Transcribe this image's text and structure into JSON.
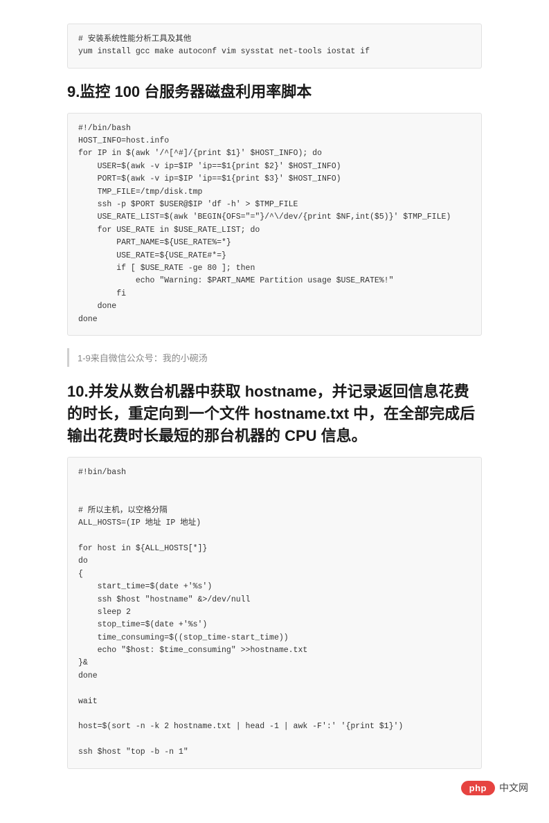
{
  "codeblock1": "# 安装系统性能分析工具及其他\nyum install gcc make autoconf vim sysstat net-tools iostat if",
  "heading1": "9.监控 100 台服务器磁盘利用率脚本",
  "codeblock2": "#!/bin/bash\nHOST_INFO=host.info\nfor IP in $(awk '/^[^#]/{print $1}' $HOST_INFO); do\n    USER=$(awk -v ip=$IP 'ip==$1{print $2}' $HOST_INFO)\n    PORT=$(awk -v ip=$IP 'ip==$1{print $3}' $HOST_INFO)\n    TMP_FILE=/tmp/disk.tmp\n    ssh -p $PORT $USER@$IP 'df -h' > $TMP_FILE\n    USE_RATE_LIST=$(awk 'BEGIN{OFS=\"=\"}/^\\/dev/{print $NF,int($5)}' $TMP_FILE)\n    for USE_RATE in $USE_RATE_LIST; do\n        PART_NAME=${USE_RATE%=*}\n        USE_RATE=${USE_RATE#*=}\n        if [ $USE_RATE -ge 80 ]; then\n            echo \"Warning: $PART_NAME Partition usage $USE_RATE%!\"\n        fi\n    done\ndone",
  "blockquote1": "1-9来自微信公众号：我的小碗汤",
  "heading2": "10.并发从数台机器中获取 hostname，并记录返回信息花费的时长，重定向到一个文件 hostname.txt 中，在全部完成后输出花费时长最短的那台机器的 CPU 信息。",
  "codeblock3": "#!bin/bash\n\n\n# 所以主机，以空格分隔\nALL_HOSTS=(IP 地址 IP 地址)\n\nfor host in ${ALL_HOSTS[*]}\ndo\n{\n    start_time=$(date +'%s')\n    ssh $host \"hostname\" &>/dev/null\n    sleep 2\n    stop_time=$(date +'%s')\n    time_consuming=$((stop_time-start_time))\n    echo \"$host: $time_consuming\" >>hostname.txt\n}&\ndone\n\nwait\n\nhost=$(sort -n -k 2 hostname.txt | head -1 | awk -F':' '{print $1}')\n\nssh $host \"top -b -n 1\"",
  "watermark": {
    "badge": "php",
    "text": "中文网"
  }
}
